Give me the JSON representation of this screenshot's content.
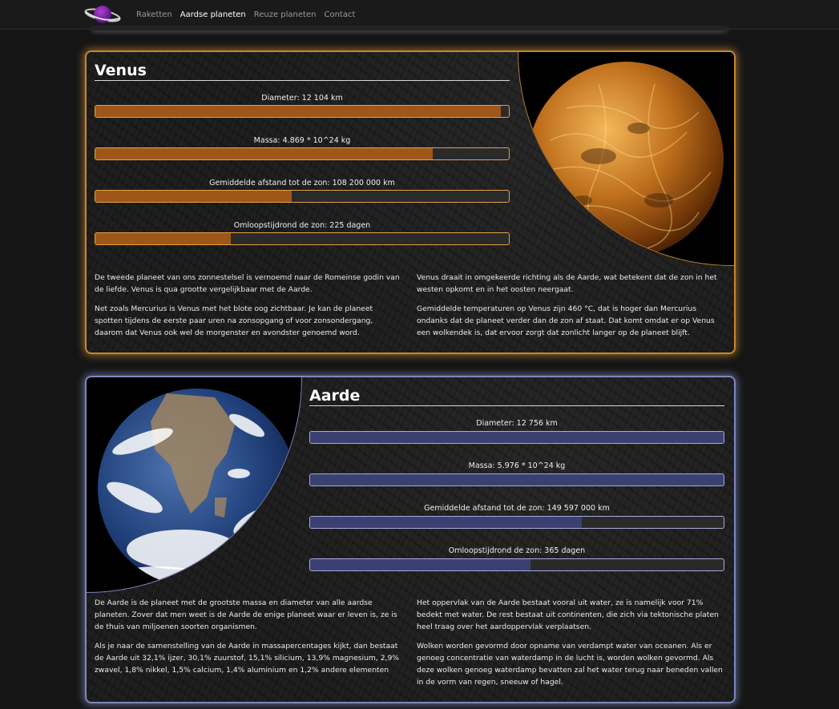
{
  "nav": {
    "links": [
      "Raketten",
      "Aardse planeten",
      "Reuze planeten",
      "Contact"
    ],
    "active_index": 1
  },
  "colors": {
    "venus_accent": "#c7862a",
    "venus_fill": "#9f5719",
    "aarde_accent": "#7f86c0",
    "aarde_fill": "#3a4170"
  },
  "venus": {
    "title": "Venus",
    "stats": [
      {
        "label": "Diameter: 12 104 km",
        "fill": 0.98
      },
      {
        "label": "Massa: 4.869 * 10^24 kg",
        "fill": 0.815
      },
      {
        "label": "Gemiddelde afstand tot de zon: 108 200 000 km",
        "fill": 0.475
      },
      {
        "label": "Omloopstijdrond de zon: 225 dagen",
        "fill": 0.328
      }
    ],
    "desc_left": [
      "De tweede planeet van ons zonnestelsel is vernoemd naar de Romeinse godin van de liefde. Venus is qua grootte vergelijkbaar met de Aarde.",
      "Net zoals Mercurius is Venus met het blote oog zichtbaar. Je kan de planeet spotten tijdens de eerste paar uren na zonsopgang of voor zonsondergang, daarom dat Venus ook wel de morgenster en avondster genoemd word."
    ],
    "desc_right": [
      "Venus draait in omgekeerde richting als de Aarde, wat betekent dat de zon in het westen opkomt en in het oosten neergaat.",
      "Gemiddelde temperaturen op Venus zijn 460 °C, dat is hoger dan Mercurius ondanks dat de planeet verder dan de zon af staat. Dat komt omdat er op Venus een wolkendek is, dat ervoor zorgt dat zonlicht langer op de planeet blijft."
    ]
  },
  "aarde": {
    "title": "Aarde",
    "stats": [
      {
        "label": "Diameter: 12 756 km",
        "fill": 1.0
      },
      {
        "label": "Massa: 5.976 * 10^24 kg",
        "fill": 1.0
      },
      {
        "label": "Gemiddelde afstand tot de zon: 149 597 000 km",
        "fill": 0.657
      },
      {
        "label": "Omloopstijdrond de zon: 365 dagen",
        "fill": 0.532
      }
    ],
    "desc_left": [
      "De Aarde is de planeet met de grootste massa en diameter van alle aardse planeten. Zover dat men weet is de Aarde de enige planeet waar er leven is, ze is de thuis van miljoenen soorten organismen.",
      "Als je naar de samenstelling van de Aarde in massapercentages kijkt, dan bestaat de Aarde uit 32,1% ijzer, 30,1% zuurstof, 15,1% silicium, 13,9% magnesium, 2,9% zwavel, 1,8% nikkel, 1,5% calcium, 1,4% aluminium en 1,2% andere elementen"
    ],
    "desc_right": [
      "Het oppervlak van de Aarde bestaat vooral uit water, ze is namelijk voor 71% bedekt met water. De rest bestaat uit continenten, die zich via tektonische platen heel traag over het aardoppervlak verplaatsen.",
      "Wolken worden gevormd door opname van verdampt water van oceanen. Als er genoeg concentratie van waterdamp in de lucht is, worden wolken gevormd. Als deze wolken genoeg waterdamp bevatten zal het water terug naar beneden vallen in de vorm van regen, sneeuw of hagel."
    ]
  }
}
